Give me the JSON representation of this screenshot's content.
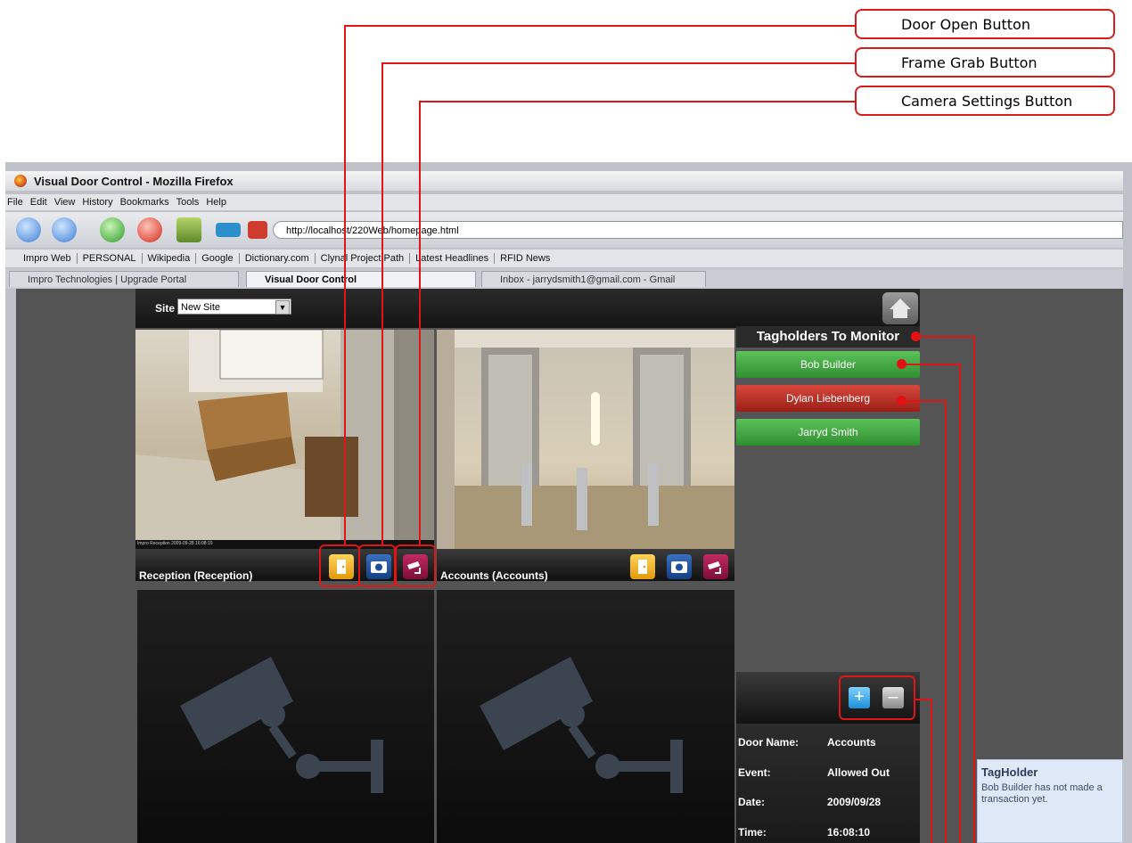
{
  "callouts": {
    "door_open": "Door Open Button",
    "frame_grab": "Frame Grab Button",
    "camera_settings": "Camera Settings Button"
  },
  "browser": {
    "title": "Visual Door Control - Mozilla Firefox",
    "menu": [
      "File",
      "Edit",
      "View",
      "History",
      "Bookmarks",
      "Tools",
      "Help"
    ],
    "url": "http://localhost/220Web/homepage.html",
    "bookmarks": [
      "Impro Web",
      "PERSONAL",
      "Wikipedia",
      "Google",
      "Dictionary.com",
      "Clynal Project Path",
      "Latest Headlines",
      "RFID News"
    ],
    "tabs": [
      "Impro Technologies | Upgrade Portal",
      "Visual Door Control",
      "Inbox - jarrydsmith1@gmail.com - Gmail"
    ]
  },
  "app": {
    "site_label": "Site",
    "site_value": "New Site",
    "cameras": [
      {
        "label": "Reception (Reception)",
        "overlay": "Impro Reception 2009-09-28 16:08:10"
      },
      {
        "label": "Accounts (Accounts)"
      }
    ],
    "tagholders_title": "Tagholders To Monitor",
    "tagholders": [
      {
        "name": "Bob Builder",
        "status": "green",
        "color": "#3ea33e"
      },
      {
        "name": "Dylan Liebenberg",
        "status": "red",
        "color": "#c12b22"
      },
      {
        "name": "Jarryd Smith",
        "status": "green",
        "color": "#3ea33e"
      }
    ],
    "event": {
      "door_label": "Door Name:",
      "door_value": "Accounts",
      "event_label": "Event:",
      "event_value": "Allowed Out",
      "date_label": "Date:",
      "date_value": "2009/09/28",
      "time_label": "Time:",
      "time_value": "16:08:10"
    },
    "tooltip": {
      "title": "TagHolder",
      "text": "Bob Builder has not made a transaction yet."
    }
  },
  "colors": {
    "accent_red": "#e01515",
    "door_button": "#f1b01a",
    "frame_button": "#1d4f9a",
    "settings_button": "#a3124a"
  }
}
